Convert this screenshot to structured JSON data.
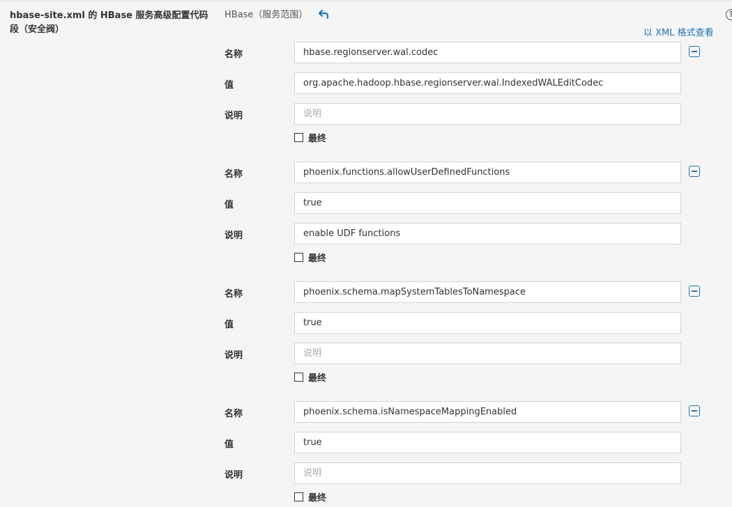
{
  "section": {
    "title": "hbase-site.xml 的 HBase 服务高级配置代码段（安全阀）",
    "scope": "HBase（服务范围）",
    "view_xml_link": "以 XML 格式查看",
    "help_glyph": "?"
  },
  "labels": {
    "name": "名称",
    "value": "值",
    "description": "说明",
    "final": "最终"
  },
  "entries": [
    {
      "name": "hbase.regionserver.wal.codec",
      "value": "org.apache.hadoop.hbase.regionserver.wal.IndexedWALEditCodec",
      "description": "",
      "description_placeholder": "说明",
      "final": false
    },
    {
      "name": "phoenix.functions.allowUserDefinedFunctions",
      "value": "true",
      "description": "enable UDF functions",
      "description_placeholder": "说明",
      "final": false
    },
    {
      "name": "phoenix.schema.mapSystemTablesToNamespace",
      "value": "true",
      "description": "",
      "description_placeholder": "说明",
      "final": false
    },
    {
      "name": "phoenix.schema.isNamespaceMappingEnabled",
      "value": "true",
      "description": "",
      "description_placeholder": "说明",
      "final": false
    }
  ],
  "icons": {
    "revert": "undo-arrow-icon",
    "remove": "minus-square-icon",
    "help": "question-circle-icon"
  },
  "colors": {
    "accent": "#1f76b6",
    "background": "#f5f5f5",
    "field_border": "#d5d5d5"
  }
}
